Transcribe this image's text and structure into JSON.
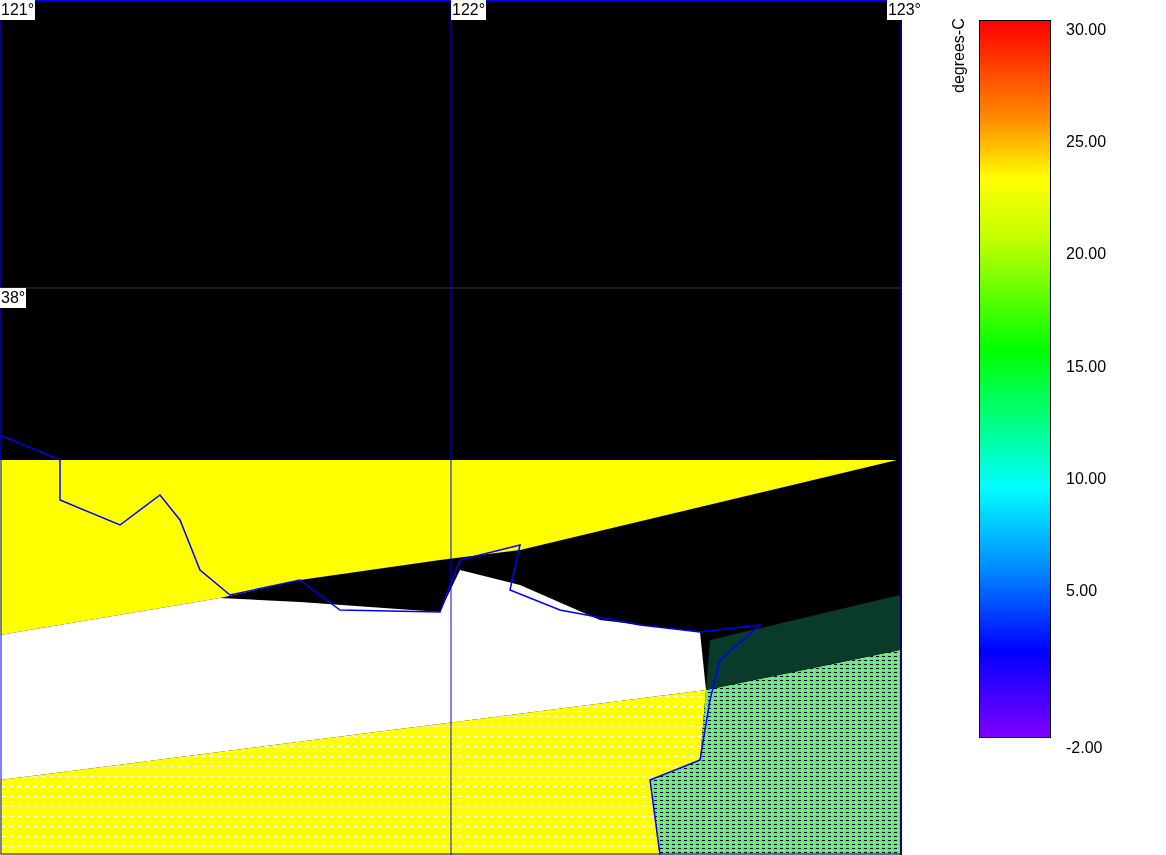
{
  "map": {
    "longitude_labels": [
      "121°",
      "122°",
      "123°"
    ],
    "latitude_labels": [
      "38°"
    ]
  },
  "color_scale": {
    "title": "degrees-C",
    "ticks": [
      "30.00",
      "25.00",
      "20.00",
      "15.00",
      "10.00",
      "5.00",
      "-2.00"
    ]
  }
}
